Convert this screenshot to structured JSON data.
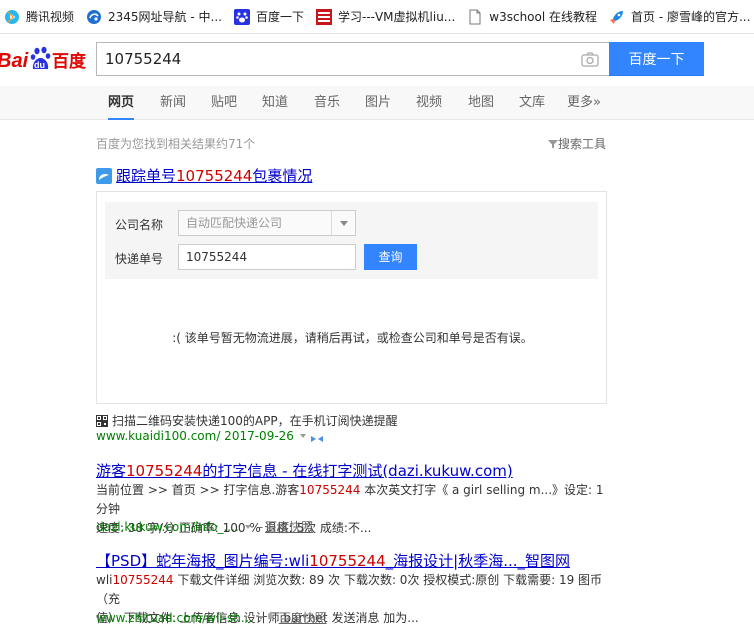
{
  "bookmarks": [
    {
      "label": "腾讯视频",
      "icon": "tencent-video-icon"
    },
    {
      "label": "2345网址导航 - 中...",
      "icon": "2345-icon"
    },
    {
      "label": "百度一下",
      "icon": "baidu-paw-icon"
    },
    {
      "label": "学习---VM虚拟机liu...",
      "icon": "blog-icon"
    },
    {
      "label": "w3school 在线教程",
      "icon": "page-icon"
    },
    {
      "label": "首页 - 廖雪峰的官方...",
      "icon": "rocket-icon"
    }
  ],
  "search": {
    "query": "10755244",
    "button_label": "百度一下"
  },
  "logo": {
    "text_bai": "Bai",
    "text_du": "du",
    "text_cn": "百度"
  },
  "tabs": [
    "网页",
    "新闻",
    "贴吧",
    "知道",
    "音乐",
    "图片",
    "视频",
    "地图",
    "文库",
    "更多»"
  ],
  "count_text": "百度为您找到相关结果约71个",
  "search_tools": "搜索工具",
  "kuaidi": {
    "title_pre": "跟踪单号",
    "title_num": "10755244",
    "title_post": "包裹情况",
    "company_label": "公司名称",
    "company_value": "自动匹配快递公司",
    "number_label": "快递单号",
    "number_value": "10755244",
    "query_label": "查询",
    "message": ":( 该单号暂无物流进展，请稍后再试，或检查公司和单号是否有误。",
    "scan_text": "扫描二维码安装快递100的APP，在手机订阅快递提醒",
    "url": "www.kuaidi100.com/ 2017-09-26"
  },
  "results": [
    {
      "title_pre": "游客",
      "title_num": "10755244",
      "title_post": "的打字信息 - 在线打字测试(dazi.kukuw.com)",
      "abs_line1_pre": "当前位置 >> 首页 >> 打字信息.游客",
      "abs_line1_num": "10755244",
      "abs_line1_post": " 本次英文打字《 a girl selling m...》设定: 1分钟",
      "abs_line2": "速度: 38 字/分 正确率: 100 % 退格: 5次 成绩:不...",
      "url": "dazi.kukuw.com/info_....",
      "snapshot": "百度快照"
    },
    {
      "title_pre": "【PSD】蛇年海报_图片编号:wli",
      "title_num": "10755244",
      "title_post": "_海报设计|秋季海..._智图网",
      "abs_line1_pre": "wli",
      "abs_line1_num": "10755244",
      "abs_line1_post": " 下载文件详细 浏览次数: 89 次 下载次数: 0次 授权模式:原创 下载需要: 19 图币（充",
      "abs_line2": "值） 下载文件: 上传者信息 设计师:barrnet 发送消息 加为...",
      "url": "www.zhituad.com/wli-sh...",
      "snapshot": "百度快照"
    }
  ]
}
